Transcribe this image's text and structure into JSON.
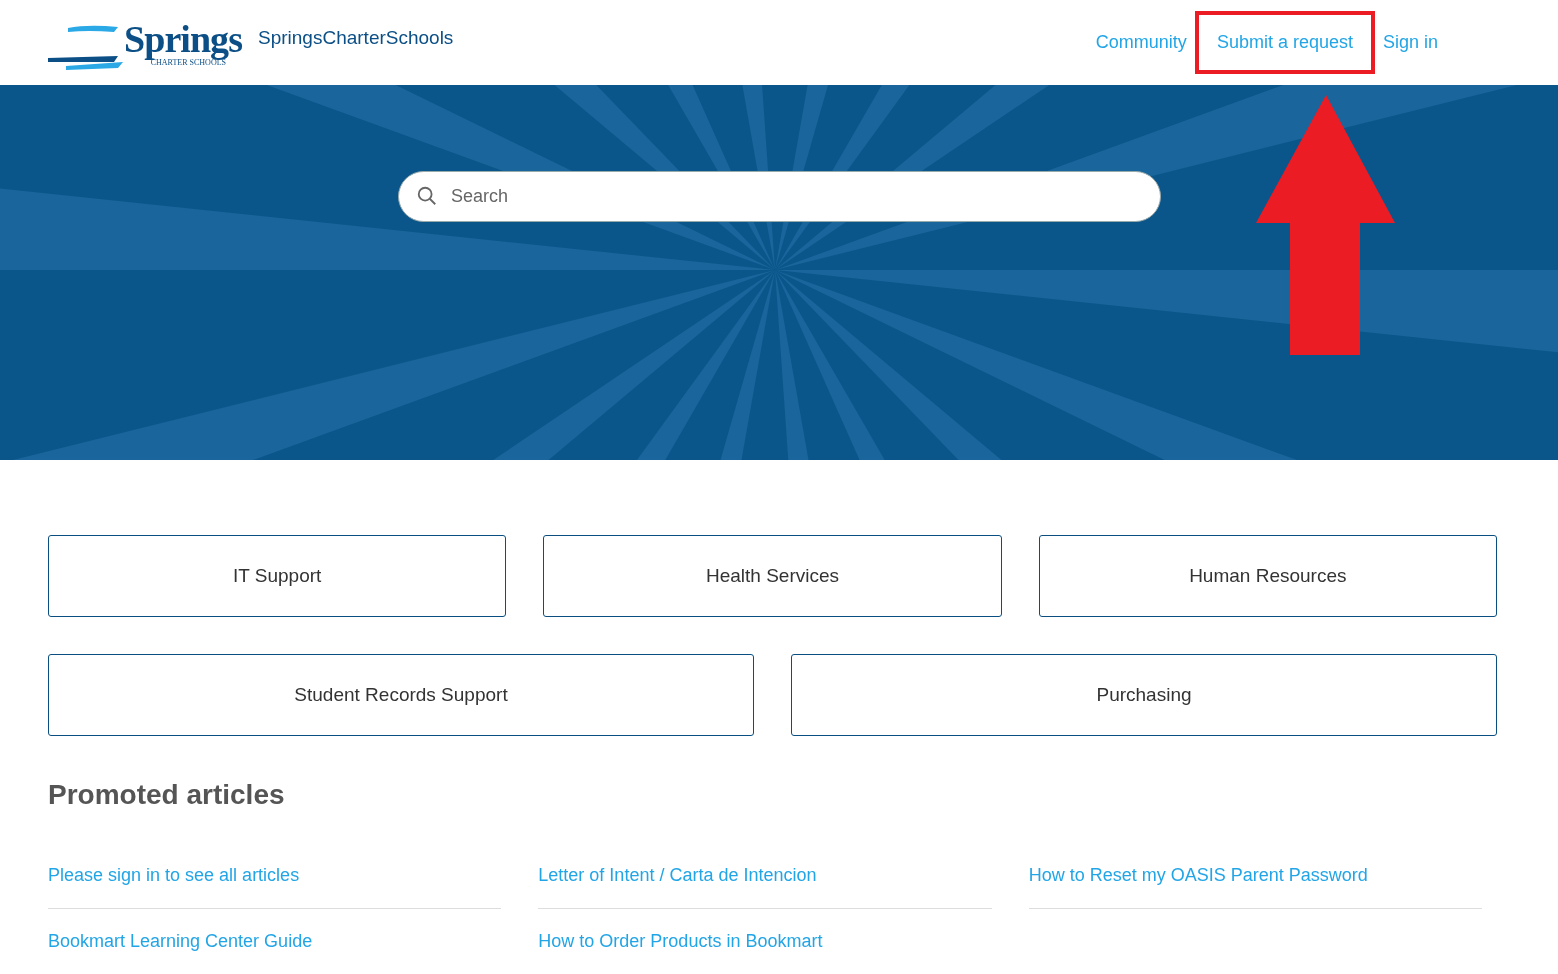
{
  "header": {
    "logo": {
      "word": "Springs",
      "tagline": "CHARTER SCHOOLS"
    },
    "brand": "SpringsCharterSchools",
    "nav": [
      {
        "label": "Community",
        "highlighted": false
      },
      {
        "label": "Submit a request",
        "highlighted": true
      },
      {
        "label": "Sign in",
        "highlighted": false
      }
    ]
  },
  "hero": {
    "search": {
      "placeholder": "Search"
    }
  },
  "categories": [
    [
      "IT Support",
      "Health Services",
      "Human Resources"
    ],
    [
      "Student Records Support",
      "Purchasing"
    ]
  ],
  "promoted": {
    "title": "Promoted articles",
    "articles": [
      "Please sign in to see all articles",
      "Letter of Intent / Carta de Intencion",
      "How to Reset my OASIS Parent Password",
      "Bookmart Learning Center Guide",
      "How to Order Products in Bookmart"
    ]
  }
}
